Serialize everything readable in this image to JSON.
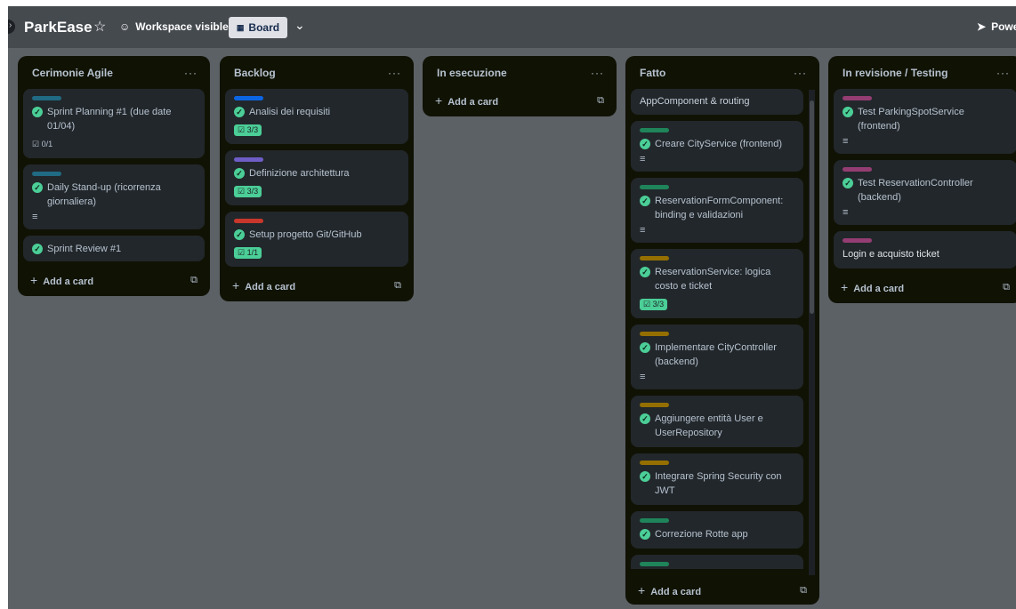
{
  "header": {
    "board_name": "ParkEase",
    "star_icon": "star-icon",
    "workspace_visible": "Workspace visible",
    "board_view": "Board",
    "power_ups": "Powe"
  },
  "lists": [
    {
      "title": "Cerimonie Agile",
      "add_label": "Add a card",
      "cards": [
        {
          "label_color": "#206a83",
          "title": "Sprint Planning #1 (due date 01/04)",
          "checklist": "0/1",
          "checklist_done": false
        },
        {
          "label_color": "#206a83",
          "title": "Daily Stand-up (ricorrenza giornaliera)",
          "has_description": true
        },
        {
          "title": "Sprint Review #1"
        }
      ]
    },
    {
      "title": "Backlog",
      "add_label": "Add a card",
      "cards": [
        {
          "label_color": "#0c66e4",
          "title": "Analisi dei requisiti",
          "checklist": "3/3",
          "checklist_done": true
        },
        {
          "label_color": "#6e5dc6",
          "title": "Definizione architettura",
          "checklist": "3/3",
          "checklist_done": true
        },
        {
          "label_color": "#c9372c",
          "title": "Setup progetto Git/GitHub",
          "checklist": "1/1",
          "checklist_done": true
        }
      ]
    },
    {
      "title": "In esecuzione",
      "add_label": "Add a card",
      "cards": []
    },
    {
      "title": "Fatto",
      "add_label": "Add a card",
      "cards": [
        {
          "title": "AppComponent & routing",
          "plain": true
        },
        {
          "label_color": "#1f845a",
          "title": "Creare CityService (frontend)",
          "has_description": true
        },
        {
          "label_color": "#1f845a",
          "title": "ReservationFormComponent: binding e validazioni",
          "has_description": true
        },
        {
          "label_color": "#946f00",
          "title": "ReservationService: logica costo e ticket",
          "checklist": "3/3",
          "checklist_done": true
        },
        {
          "label_color": "#946f00",
          "title": "Implementare CityController (backend)",
          "has_description": true
        },
        {
          "label_color": "#946f00",
          "title": "Aggiungere entità User e UserRepository"
        },
        {
          "label_color": "#946f00",
          "title": "Integrare Spring Security con JWT"
        },
        {
          "label_color": "#1f845a",
          "title": "Correzione Rotte app"
        },
        {
          "label_color": "#1f845a",
          "title": ""
        }
      ]
    },
    {
      "title": "In revisione / Testing",
      "add_label": "Add a card",
      "cards": [
        {
          "label_color": "#943d73",
          "title": "Test ParkingSpotService (frontend)",
          "has_description": true
        },
        {
          "label_color": "#943d73",
          "title": "Test ReservationController (backend)",
          "has_description": true
        },
        {
          "label_color": "#943d73",
          "title": "Login e acquisto ticket",
          "plain": true
        }
      ]
    }
  ]
}
